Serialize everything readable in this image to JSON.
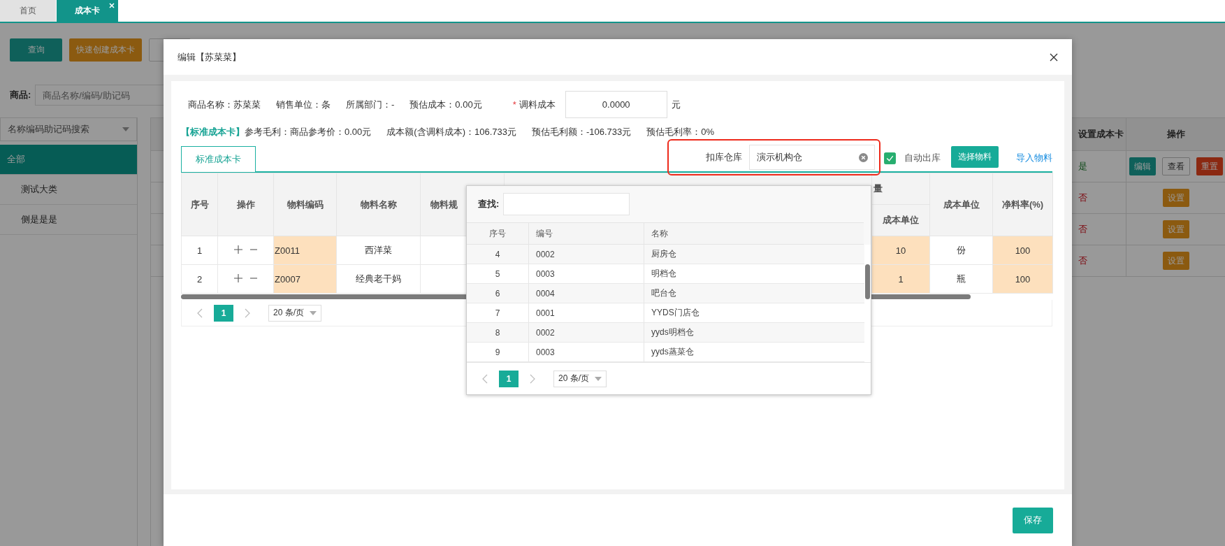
{
  "tabs": [
    {
      "label": "首页",
      "selected": false,
      "closable": false
    },
    {
      "label": "成本卡",
      "selected": true,
      "closable": true
    }
  ],
  "toolbar": [
    {
      "label": "查询",
      "kind": "primary"
    },
    {
      "label": "快速创建成本卡",
      "kind": "warning"
    }
  ],
  "filter": {
    "label": "商品:",
    "placeholder": "商品名称/编码/助记码"
  },
  "sidebar": {
    "search_mode": "名称编码助记码搜索",
    "items": [
      {
        "label": "全部",
        "selected": true
      },
      {
        "label": "测试大类",
        "selected": false
      },
      {
        "label": "侧是是是",
        "selected": false
      }
    ]
  },
  "table": {
    "columns": [
      "设置成本卡",
      "操作"
    ],
    "rows": [
      {
        "status": "是",
        "positive": true,
        "actions": [
          {
            "label": "编辑",
            "kind": "primary"
          },
          {
            "label": "查看",
            "kind": "default"
          },
          {
            "label": "重置",
            "kind": "danger"
          }
        ]
      },
      {
        "status": "否",
        "positive": false,
        "actions": [
          {
            "label": "设置",
            "kind": "warning"
          }
        ]
      },
      {
        "status": "否",
        "positive": false,
        "actions": [
          {
            "label": "设置",
            "kind": "warning"
          }
        ]
      },
      {
        "status": "否",
        "positive": false,
        "actions": [
          {
            "label": "设置",
            "kind": "warning"
          }
        ]
      }
    ]
  },
  "dialog": {
    "title": "编辑【苏菜菜】",
    "info": [
      "商品名称：苏菜菜",
      "销售单位：条",
      "所属部门：-",
      "预估成本：0.00元"
    ],
    "seasoning_cost": {
      "label": "调料成本",
      "required_mark": "*",
      "value": "0.0000",
      "unit": "元"
    },
    "summary": {
      "tag": "【标准成本卡】",
      "items": [
        "参考毛利：商品参考价：0.00元",
        "成本额(含调料成本)：106.733元",
        "预估毛利额：-106.733元",
        "预估毛利率：0%"
      ]
    },
    "tabs": [
      {
        "label": "标准成本卡",
        "selected": true
      }
    ],
    "warehouse": {
      "label": "扣库仓库",
      "value": "演示机构仓",
      "highlighted": true
    },
    "auto_out": {
      "label": "自动出库",
      "checked": true
    },
    "select_button": "选择物料",
    "import_link": "导入物料",
    "materials": {
      "columns": [
        "序号",
        "操作",
        "物料编码",
        "物料名称",
        "物料规"
      ],
      "group": "量",
      "sub_column": "成本单位",
      "right_columns": [
        "成本单位",
        "净料率(%)"
      ],
      "rows": [
        {
          "index": "1",
          "code": "Z0011",
          "name": "西洋菜",
          "qty": "10",
          "unit": "份",
          "rate": "100"
        },
        {
          "index": "2",
          "code": "Z0007",
          "name": "经典老干妈",
          "qty": "1",
          "unit": "瓶",
          "rate": "100"
        }
      ]
    },
    "pagination": {
      "page": "1",
      "page_size": "20 条/页"
    },
    "warehouse_popup": {
      "search_label": "查找:",
      "columns": [
        "序号",
        "编号",
        "名称"
      ],
      "rows": [
        {
          "index": "4",
          "code": "0002",
          "name": "厨房仓"
        },
        {
          "index": "5",
          "code": "0003",
          "name": "明档仓"
        },
        {
          "index": "6",
          "code": "0004",
          "name": "吧台仓"
        },
        {
          "index": "7",
          "code": "0001",
          "name": "YYDS门店仓"
        },
        {
          "index": "8",
          "code": "0002",
          "name": "yyds明档仓"
        },
        {
          "index": "9",
          "code": "0003",
          "name": "yyds蒸菜仓"
        }
      ],
      "pagination": {
        "page": "1",
        "page_size": "20 条/页"
      }
    },
    "save_button": "保存"
  }
}
